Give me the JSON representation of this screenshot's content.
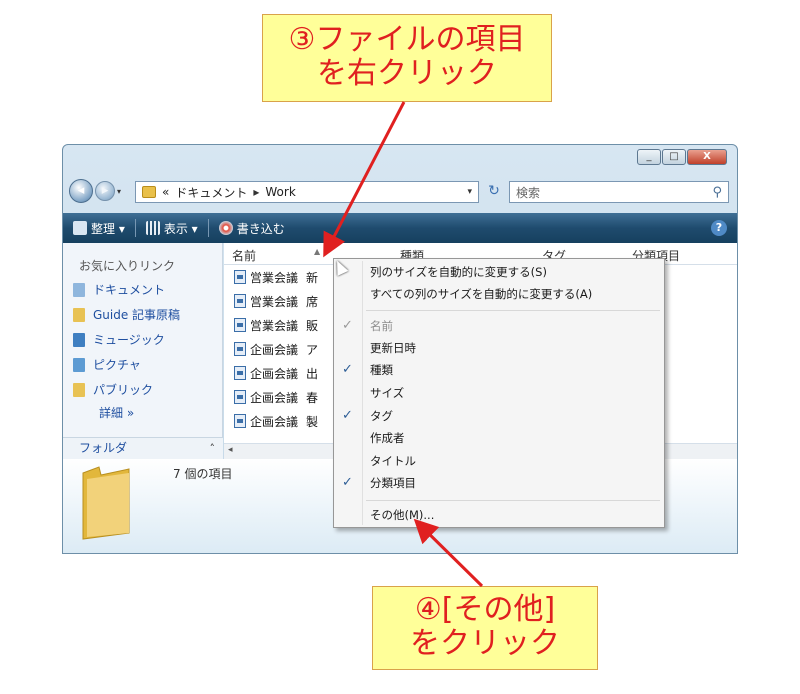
{
  "callouts": {
    "top": {
      "line1": "③ファイルの項目",
      "line2": "を右クリック"
    },
    "bottom": {
      "line1": "④[その他]",
      "line2": "をクリック"
    }
  },
  "window": {
    "caption_buttons": [
      "_",
      "□",
      "X"
    ],
    "address": {
      "prefix": "«",
      "folder": "ドキュメント",
      "separator": "▸",
      "current": "Work",
      "dropdown": "▾"
    },
    "search_placeholder": "検索",
    "toolbar": {
      "organize": "整理 ▾",
      "view": "表示 ▾",
      "burn": "書き込む",
      "help": "?"
    },
    "favorites_title": "お気に入りリンク",
    "favorites": [
      {
        "label": "ドキュメント",
        "color": "#8fb6dd"
      },
      {
        "label": "Guide 記事原稿",
        "color": "#e8c254"
      },
      {
        "label": "ミュージック",
        "color": "#3f7fc1"
      },
      {
        "label": "ピクチャ",
        "color": "#5d9bd3"
      },
      {
        "label": "パブリック",
        "color": "#e8c254"
      }
    ],
    "favorites_more": "詳細 »",
    "folder_label": "フォルダ",
    "folder_chevron": "˄",
    "columns": {
      "name": "名前",
      "type": "種類",
      "tags": "タグ",
      "category": "分類項目",
      "sort": "▲"
    },
    "files": [
      {
        "a": "営業会議",
        "b": "新"
      },
      {
        "a": "営業会議",
        "b": "席"
      },
      {
        "a": "営業会議",
        "b": "販"
      },
      {
        "a": "企画会議",
        "b": "ア"
      },
      {
        "a": "企画会議",
        "b": "出"
      },
      {
        "a": "企画会議",
        "b": "春"
      },
      {
        "a": "企画会議",
        "b": "製"
      }
    ],
    "hscroll_left": "◂",
    "item_count": "7 個の項目"
  },
  "context_menu": {
    "auto_size": "列のサイズを自動的に変更する(S)",
    "auto_size_all": "すべての列のサイズを自動的に変更する(A)",
    "columns": [
      {
        "label": "名前",
        "checked": true,
        "disabled": true
      },
      {
        "label": "更新日時",
        "checked": false,
        "disabled": false
      },
      {
        "label": "種類",
        "checked": true,
        "disabled": false
      },
      {
        "label": "サイズ",
        "checked": false,
        "disabled": false
      },
      {
        "label": "タグ",
        "checked": true,
        "disabled": false
      },
      {
        "label": "作成者",
        "checked": false,
        "disabled": false
      },
      {
        "label": "タイトル",
        "checked": false,
        "disabled": false
      },
      {
        "label": "分類項目",
        "checked": true,
        "disabled": false
      }
    ],
    "more": "その他(M)..."
  },
  "annotation_color": "#e02020"
}
